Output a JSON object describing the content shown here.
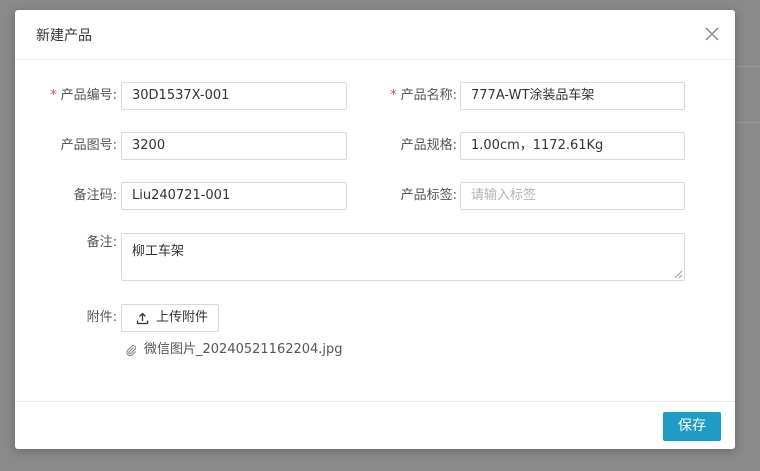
{
  "modal": {
    "title": "新建产品",
    "save_label": "保存"
  },
  "form": {
    "product_code": {
      "label": "产品编号:",
      "value": "30D1537X-001",
      "required": true
    },
    "product_name": {
      "label": "产品名称:",
      "value": "777A-WT涂装品车架",
      "required": true
    },
    "drawing_no": {
      "label": "产品图号:",
      "value": "3200"
    },
    "spec": {
      "label": "产品规格:",
      "value": "1.00cm，1172.61Kg"
    },
    "remark_code": {
      "label": "备注码:",
      "value": "Liu240721-001"
    },
    "tags": {
      "label": "产品标签:",
      "value": "",
      "placeholder": "请输入标签"
    },
    "remark": {
      "label": "备注:",
      "value": "柳工车架"
    },
    "attachment": {
      "label": "附件:",
      "upload_label": "上传附件",
      "files": [
        "微信图片_20240521162204.jpg"
      ]
    }
  },
  "colors": {
    "primary": "#1e9bc7",
    "required": "#e5484d",
    "backdrop": "#8a8a8a"
  },
  "icons": {
    "close": "close-icon",
    "upload": "upload-icon",
    "attachment": "paperclip-icon"
  }
}
